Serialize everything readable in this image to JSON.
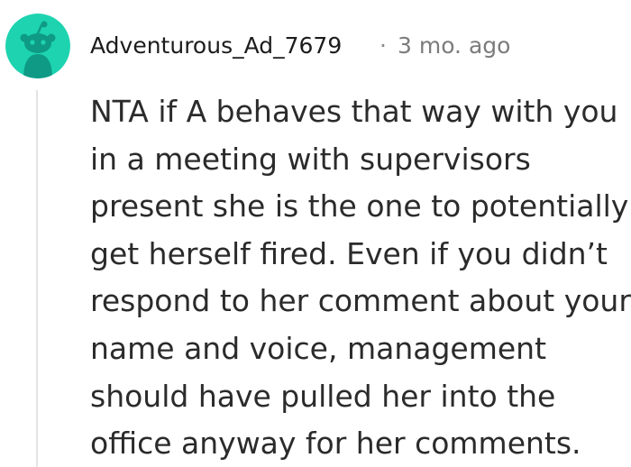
{
  "comment": {
    "username": "Adventurous_Ad_7679",
    "separator": "·",
    "timestamp": "3 mo. ago",
    "body_lines": [
      "NTA if A behaves that way with you",
      "in a meeting with supervisors",
      "present she is the one to potentially",
      "get herself fired. Even if you didn’t",
      "respond to her comment about your",
      "name and voice, management",
      "should have pulled her into the",
      "office anyway for her comments."
    ]
  },
  "avatar": {
    "icon": "snoo-avatar-icon",
    "background_color": "#1dd3b0",
    "figure_color": "#0e9a85"
  },
  "colors": {
    "username": "#1c1c1c",
    "timestamp": "#7c7c7c",
    "body_text": "#2b2b2b",
    "thread_line": "#e4e4e4"
  }
}
